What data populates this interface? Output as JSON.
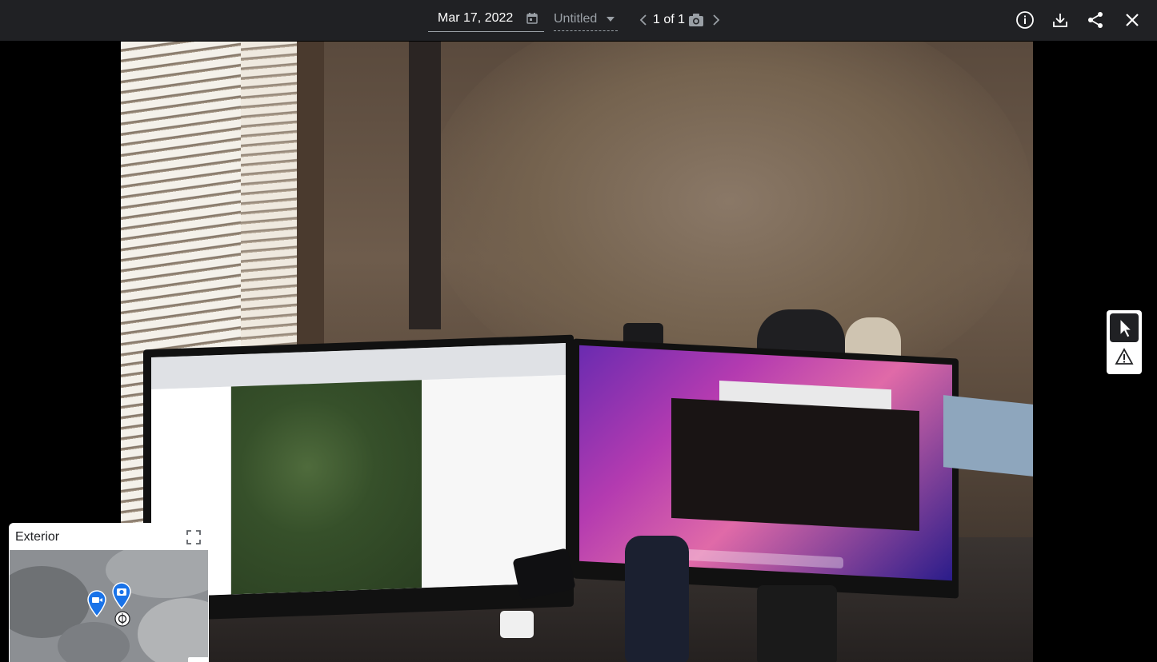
{
  "header": {
    "date": "Mar 17, 2022",
    "title": "Untitled",
    "counter": "1 of 1",
    "icons": [
      "calendar-icon",
      "caret-down-icon",
      "chevron-left-icon",
      "camera-icon",
      "chevron-right-icon",
      "info-icon",
      "download-icon",
      "share-icon",
      "close-icon"
    ]
  },
  "tools": {
    "icons": [
      "cursor-icon",
      "warning-icon"
    ],
    "selected": "cursor"
  },
  "minimap": {
    "label": "Exterior",
    "zoom_in": "+",
    "zoom_out": "−",
    "pins": [
      "video-pin-icon",
      "photo-pin-icon",
      "panorama-icon"
    ],
    "pin_color": "#1a73e8"
  },
  "colors": {
    "topbar": "#202124",
    "accent": "#1a73e8"
  }
}
